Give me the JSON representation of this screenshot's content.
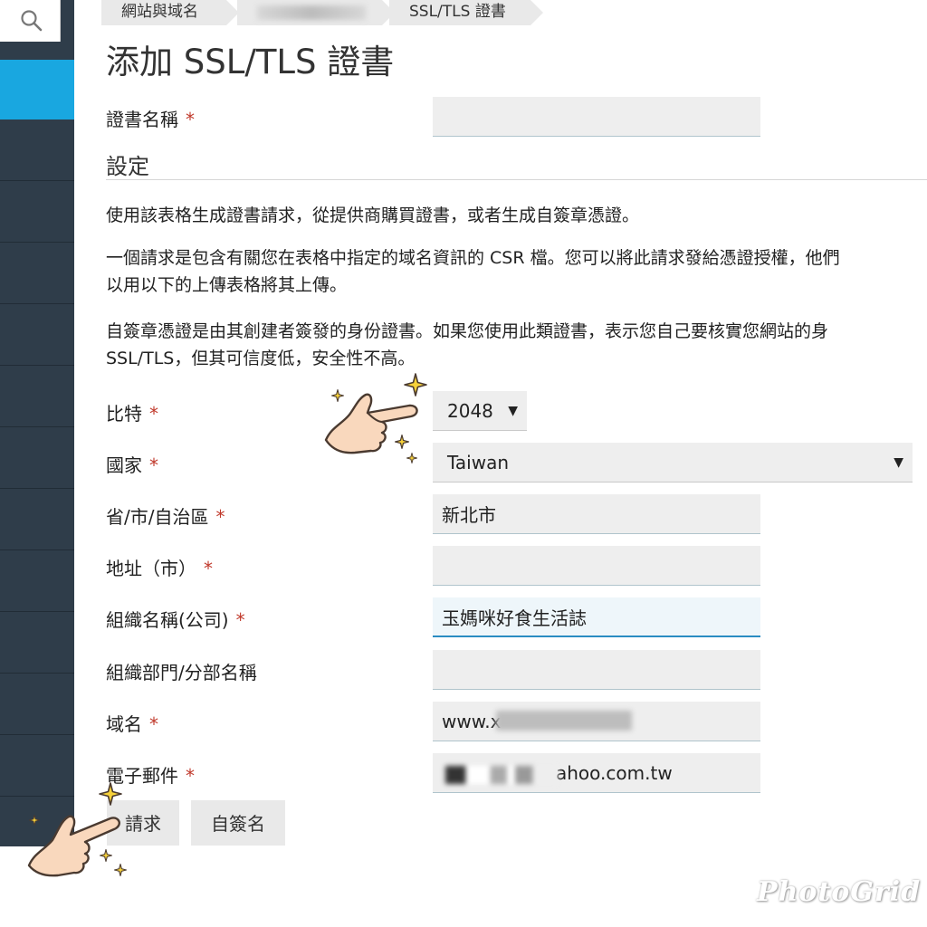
{
  "breadcrumb": {
    "items": [
      {
        "label": "網站與域名"
      },
      {
        "label": ""
      },
      {
        "label": "SSL/TLS 證書"
      }
    ]
  },
  "page": {
    "title": "添加 SSL/TLS 證書"
  },
  "required_mark": "*",
  "certificate_name": {
    "label": "證書名稱",
    "value": ""
  },
  "settings": {
    "heading": "設定",
    "paragraphs": [
      [
        "使用該表格生成證書請求，從提供商購買證書，或者生成自簽章憑證。"
      ],
      [
        "一個請求是包含有關您在表格中指定的域名資訊的 CSR 檔。您可以將此請求發給憑證授權，他們",
        "以用以下的上傳表格將其上傳。"
      ],
      [
        "自簽章憑證是由其創建者簽發的身份證書。如果您使用此類證書，表示您自己要核實您網站的身",
        "SSL/TLS，但其可信度低，安全性不高。"
      ]
    ]
  },
  "form": {
    "bits": {
      "label": "比特",
      "value": "2048"
    },
    "country": {
      "label": "國家",
      "value": "Taiwan"
    },
    "province": {
      "label": "省/市/自治區",
      "value": "新北市"
    },
    "city": {
      "label": "地址（市）",
      "value": ""
    },
    "organization": {
      "label": "組織名稱(公司)",
      "value": "玉媽咪好食生活誌"
    },
    "department": {
      "label": "組織部門/分部名稱",
      "value": ""
    },
    "domain": {
      "label": "域名",
      "value": "www.x"
    },
    "email": {
      "label": "電子郵件",
      "value": "ahoo.com.tw"
    }
  },
  "buttons": {
    "request": "請求",
    "self_sign": "自簽名"
  },
  "watermark": "PhotoGrid",
  "colors": {
    "sidebar": "#2f3d4a",
    "sidebar_active": "#19a7e0",
    "required": "#c0392b"
  }
}
